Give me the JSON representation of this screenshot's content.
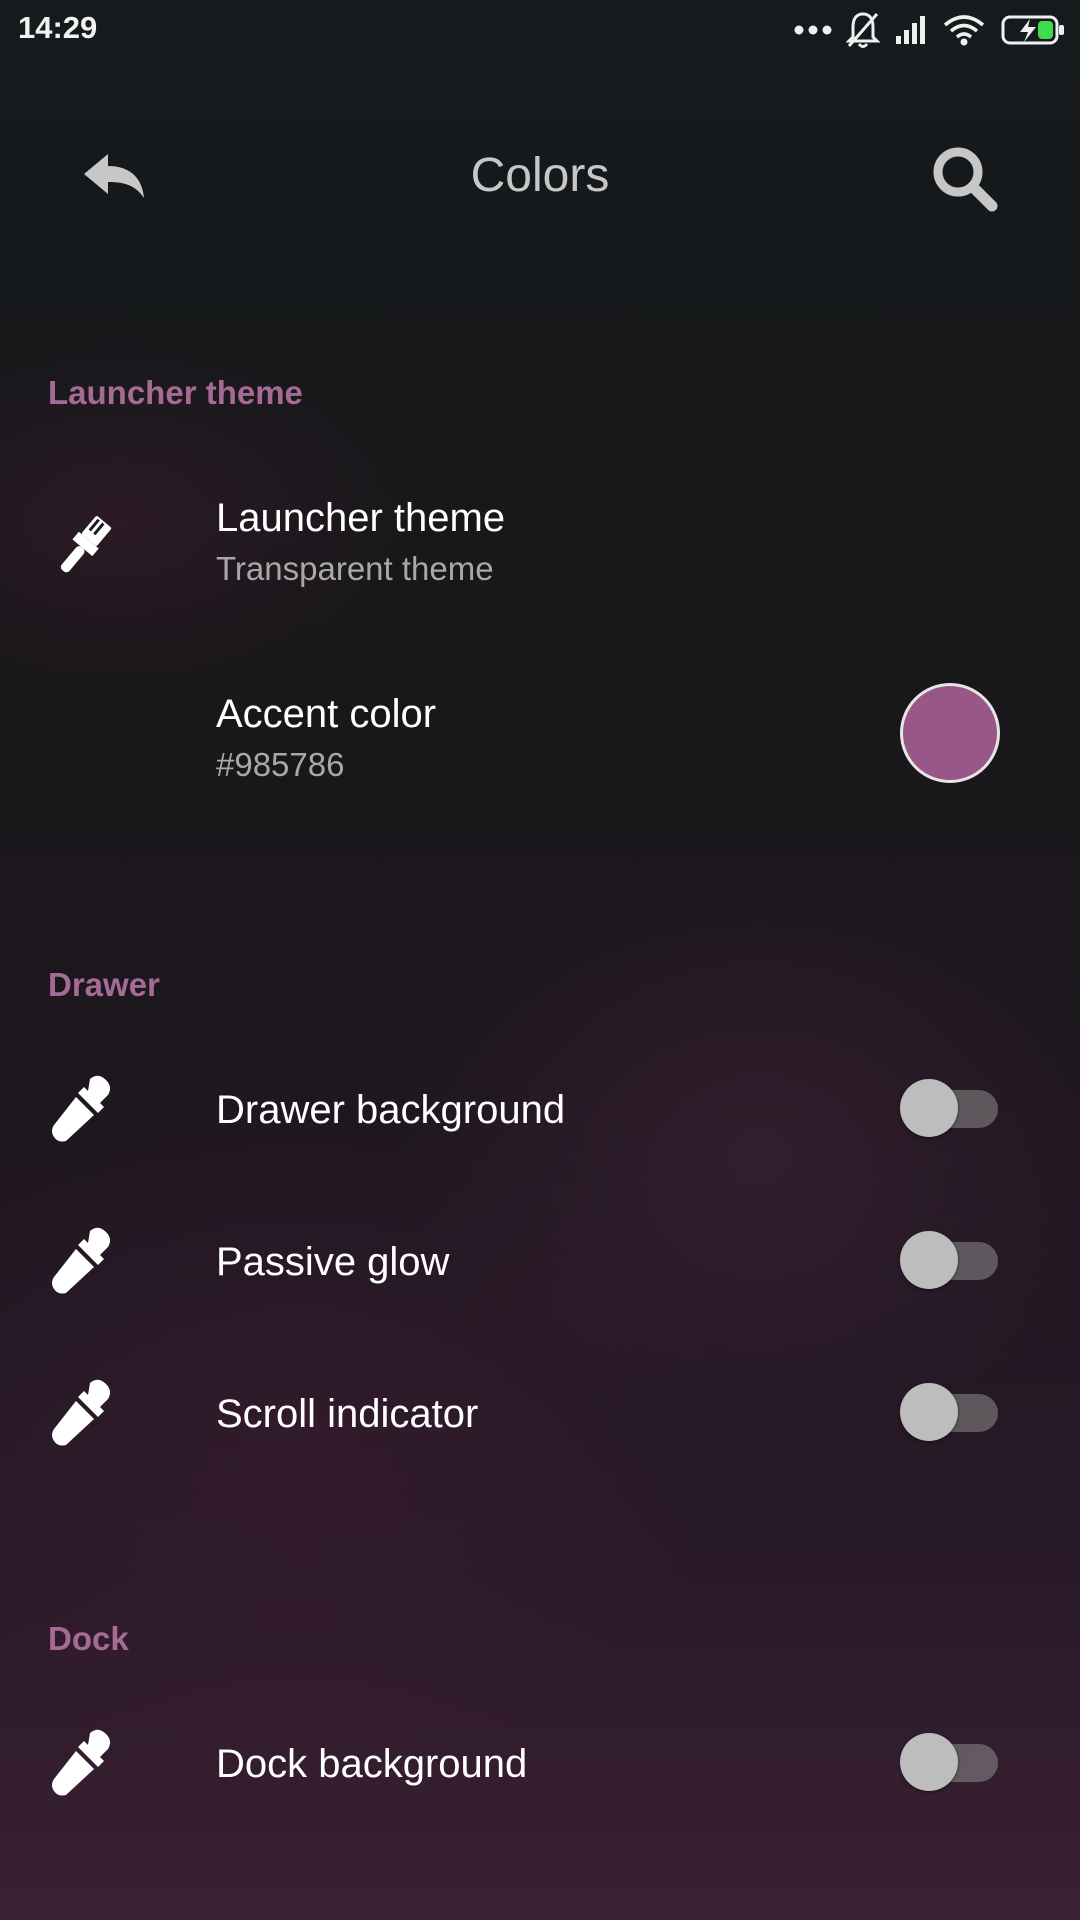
{
  "status_bar": {
    "time": "14:29",
    "icons": [
      "more-dots-icon",
      "notifications-off-icon",
      "signal-icon",
      "wifi-icon",
      "battery-charging-icon"
    ]
  },
  "app_bar": {
    "title": "Colors",
    "back_icon": "back-arrow-icon",
    "search_icon": "search-icon"
  },
  "sections": {
    "launcher_theme": {
      "header": "Launcher theme",
      "theme_row": {
        "title": "Launcher theme",
        "subtitle": "Transparent theme",
        "icon": "paint-brush-icon"
      },
      "accent_row": {
        "title": "Accent color",
        "subtitle": "#985786",
        "swatch_color": "#985786"
      }
    },
    "drawer": {
      "header": "Drawer",
      "items": [
        {
          "title": "Drawer background",
          "icon": "eyedropper-icon",
          "toggle_on": false
        },
        {
          "title": "Passive glow",
          "icon": "eyedropper-icon",
          "toggle_on": false
        },
        {
          "title": "Scroll indicator",
          "icon": "eyedropper-icon",
          "toggle_on": false
        }
      ]
    },
    "dock": {
      "header": "Dock",
      "items": [
        {
          "title": "Dock background",
          "icon": "eyedropper-icon",
          "toggle_on": false
        }
      ]
    }
  },
  "colors": {
    "accent": "#985786",
    "section_header": "#a56a95",
    "primary_text": "#ffffff",
    "secondary_text": "#a8a8a8"
  }
}
